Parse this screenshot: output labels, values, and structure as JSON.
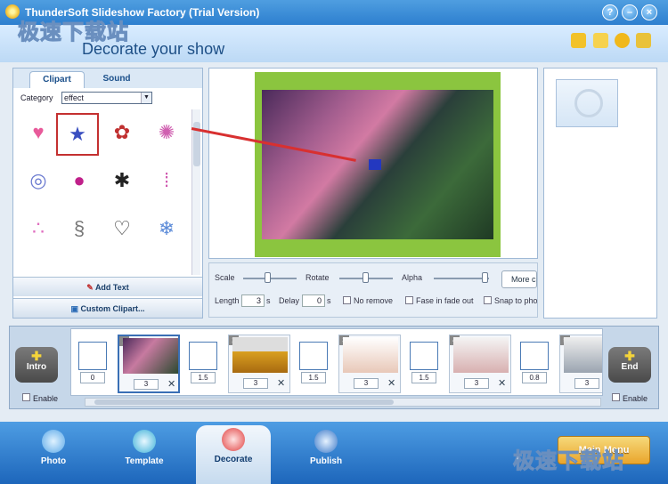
{
  "window": {
    "title": "ThunderSoft Slideshow Factory (Trial Version)",
    "subtitle": "Decorate your show",
    "watermark": "极速下载站"
  },
  "tabs": [
    {
      "label": "Clipart"
    },
    {
      "label": "Sound"
    }
  ],
  "category": {
    "label": "Category",
    "value": "effect"
  },
  "clipart_icons": [
    "heart-clip",
    "stars-clip",
    "butterfly-clip",
    "splash-clip",
    "ring-clip",
    "lips-clip",
    "bug-clip",
    "hanging-drops-clip",
    "pink-drops-clip",
    "swirl-clip",
    "heart-outline-clip",
    "snowflake-clip"
  ],
  "left_buttons": {
    "add_text": "Add Text",
    "custom_clipart": "Custom Clipart..."
  },
  "controls": {
    "scale": "Scale",
    "rotate": "Rotate",
    "alpha": "Alpha",
    "more": "More c",
    "length_label": "Length",
    "length_value": "3",
    "length_unit": "s",
    "delay_label": "Delay",
    "delay_value": "0",
    "delay_unit": "s",
    "no_remove": "No remove",
    "fade": "Fase in fade out",
    "snap": "Snap to pho"
  },
  "timeline": {
    "intro": "Intro",
    "end": "End",
    "enable": "Enable",
    "items": [
      {
        "kind": "transition",
        "value": "0"
      },
      {
        "kind": "slide",
        "n": "1",
        "duration": "3",
        "color": "#6a4a7a"
      },
      {
        "kind": "transition",
        "value": "1.5"
      },
      {
        "kind": "slide",
        "n": "2",
        "duration": "3",
        "color": "#d9a020"
      },
      {
        "kind": "transition",
        "value": "1.5"
      },
      {
        "kind": "slide",
        "n": "3",
        "duration": "3",
        "color": "#e8c8b8"
      },
      {
        "kind": "transition",
        "value": "1.5"
      },
      {
        "kind": "slide",
        "n": "4",
        "duration": "3",
        "color": "#d8b0b0"
      },
      {
        "kind": "transition",
        "value": "0.8"
      },
      {
        "kind": "slide",
        "n": "5",
        "duration": "3",
        "color": "#9aa4b0"
      }
    ]
  },
  "nav": [
    {
      "label": "Photo"
    },
    {
      "label": "Template"
    },
    {
      "label": "Decorate"
    },
    {
      "label": "Publish"
    }
  ],
  "main_menu": "Main Menu"
}
